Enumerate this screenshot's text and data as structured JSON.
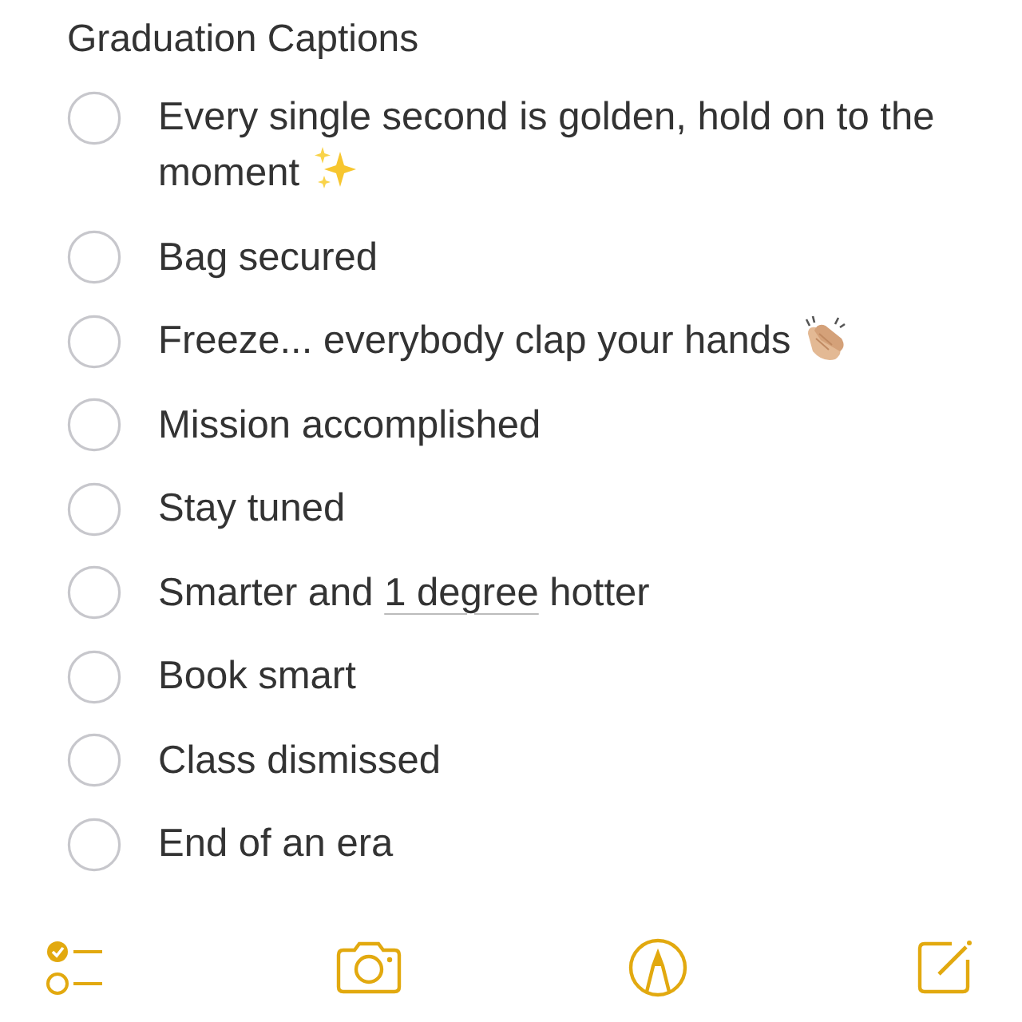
{
  "note": {
    "title": "Graduation Captions",
    "items": [
      {
        "checked": false,
        "segments": [
          {
            "kind": "plain",
            "text": "Every single second is golden, hold on to the moment"
          },
          {
            "kind": "sparkles"
          }
        ]
      },
      {
        "checked": false,
        "segments": [
          {
            "kind": "plain",
            "text": "Bag secured"
          }
        ]
      },
      {
        "checked": false,
        "segments": [
          {
            "kind": "plain",
            "text": "Freeze... everybody clap your hands"
          },
          {
            "kind": "clap"
          }
        ]
      },
      {
        "checked": false,
        "segments": [
          {
            "kind": "plain",
            "text": "Mission accomplished"
          }
        ]
      },
      {
        "checked": false,
        "segments": [
          {
            "kind": "plain",
            "text": "Stay tuned"
          }
        ]
      },
      {
        "checked": false,
        "segments": [
          {
            "kind": "plain",
            "text": "Smarter and "
          },
          {
            "kind": "detected",
            "text": "1 degree"
          },
          {
            "kind": "plain",
            "text": " hotter"
          }
        ]
      },
      {
        "checked": false,
        "segments": [
          {
            "kind": "plain",
            "text": "Book smart"
          }
        ]
      },
      {
        "checked": false,
        "segments": [
          {
            "kind": "plain",
            "text": "Class dismissed"
          }
        ]
      },
      {
        "checked": false,
        "segments": [
          {
            "kind": "plain",
            "text": "End of an era"
          }
        ]
      }
    ]
  },
  "toolbar": [
    {
      "kind": "checklist"
    },
    {
      "kind": "camera"
    },
    {
      "kind": "markup"
    },
    {
      "kind": "compose"
    }
  ]
}
